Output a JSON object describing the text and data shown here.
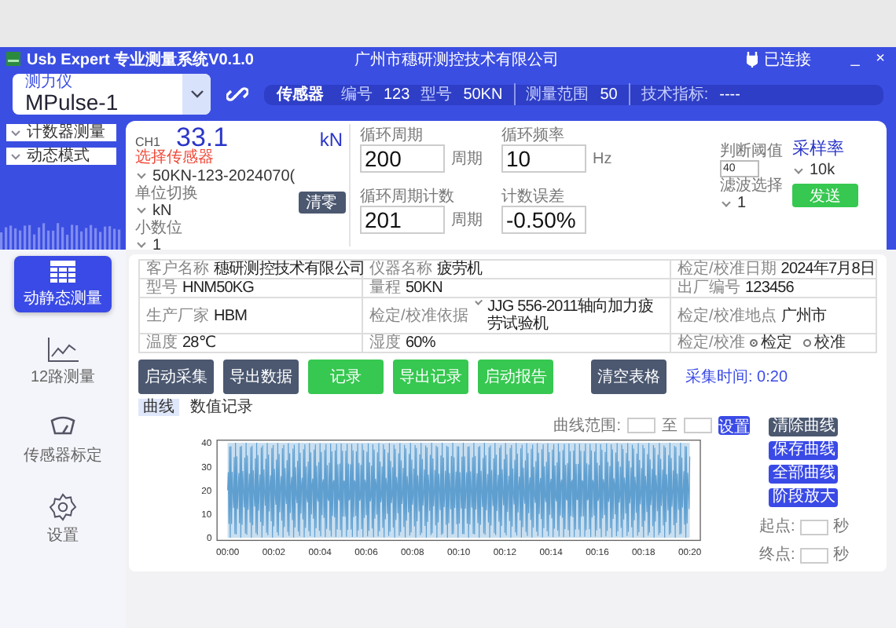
{
  "window": {
    "title": "Usb Expert 专业测量系统V0.1.0",
    "company": "广州市穗研测控技术有限公司",
    "connection": "已连接",
    "minimize": "_",
    "close": "×"
  },
  "device": {
    "label": "测力仪",
    "value": "MPulse-1"
  },
  "sensor_bar": {
    "title": "传感器",
    "fields": [
      {
        "label": "编号",
        "value": "123"
      },
      {
        "label": "型号",
        "value": "50KN"
      },
      {
        "label": "测量范围",
        "value": "50"
      },
      {
        "label": "技术指标:",
        "value": "----"
      }
    ]
  },
  "mode_selects": [
    "计数器测量",
    "动态模式"
  ],
  "channel": {
    "name": "CH1",
    "reading": "33.1",
    "unit": "kN",
    "sensor_label": "选择传感器",
    "sensor": "50KN-123-2024070(",
    "unit_label": "单位切换",
    "unit_value": "kN",
    "decimals_label": "小数位",
    "decimals": "1",
    "zero_button": "清零"
  },
  "params": [
    {
      "label": "循环周期",
      "value": "200",
      "unit": "周期"
    },
    {
      "label": "循环周期计数",
      "value": "201",
      "unit": "周期"
    },
    {
      "label": "循环频率",
      "value": "10",
      "unit": "Hz"
    },
    {
      "label": "计数误差",
      "value": "-0.50%"
    }
  ],
  "threshold": {
    "label": "判断阈值",
    "value": "40"
  },
  "filter": {
    "label": "滤波选择",
    "value": "1"
  },
  "sampling": {
    "label": "采样率",
    "value": "10k"
  },
  "send_button": "发送",
  "nav": [
    {
      "label": "动静态测量",
      "selected": true
    },
    {
      "label": "12路测量",
      "selected": false
    },
    {
      "label": "传感器标定",
      "selected": false
    },
    {
      "label": "设置",
      "selected": false
    }
  ],
  "info_table": [
    [
      {
        "label": "客户名称",
        "value": "穗研测控技术有限公司"
      },
      {
        "label": "仪器名称",
        "value": "疲劳机"
      },
      {
        "label": "检定/校准日期",
        "value": "2024年7月8日"
      }
    ],
    [
      {
        "label": "型号",
        "value": "HNM50KG"
      },
      {
        "label": "量程",
        "value": "50KN"
      },
      {
        "label": "出厂编号",
        "value": "123456"
      }
    ],
    [
      {
        "label": "生产厂家",
        "value": "HBM"
      },
      {
        "label": "检定/校准依据",
        "kind": "select",
        "value": "JJG 556-2011轴向加力疲劳试验机"
      },
      {
        "label": "检定/校准地点",
        "value": "广州市"
      }
    ],
    [
      {
        "label": "温度",
        "value": "28℃"
      },
      {
        "label": "湿度",
        "value": "60%"
      },
      {
        "label": "检定/校准",
        "kind": "radio",
        "options": [
          {
            "label": "检定",
            "selected": true
          },
          {
            "label": "校准",
            "selected": false
          }
        ]
      }
    ]
  ],
  "actions": [
    {
      "label": "启动采集",
      "color": "#4b5870"
    },
    {
      "label": "导出数据",
      "color": "#4b5870"
    },
    {
      "label": "记录",
      "color": "#36c850"
    },
    {
      "label": "导出记录",
      "color": "#36c850"
    },
    {
      "label": "启动报告",
      "color": "#36c850"
    },
    {
      "label": "清空表格",
      "color": "#4b5870"
    }
  ],
  "acquisition": "采集时间: 0:20",
  "tabs": [
    {
      "label": "曲线",
      "selected": true
    },
    {
      "label": "数值记录",
      "selected": false
    }
  ],
  "range": {
    "label": "曲线范围:",
    "to": "至",
    "button": "设置"
  },
  "chart": {
    "yticks": [
      "40",
      "30",
      "20",
      "10",
      "0"
    ],
    "xticks": [
      "00:00",
      "00:02",
      "00:04",
      "00:06",
      "00:08",
      "00:10",
      "00:12",
      "00:14",
      "00:16",
      "00:18",
      "00:20"
    ]
  },
  "side_buttons": [
    {
      "label": "清除曲线",
      "color": "#4b5870"
    },
    {
      "label": "保存曲线",
      "color": "#3a4ae6"
    },
    {
      "label": "全部曲线",
      "color": "#3a4ae6"
    },
    {
      "label": "阶段放大",
      "color": "#3a4ae6"
    }
  ],
  "start": {
    "label": "起点:",
    "unit": "秒"
  },
  "end": {
    "label": "终点:",
    "unit": "秒"
  }
}
